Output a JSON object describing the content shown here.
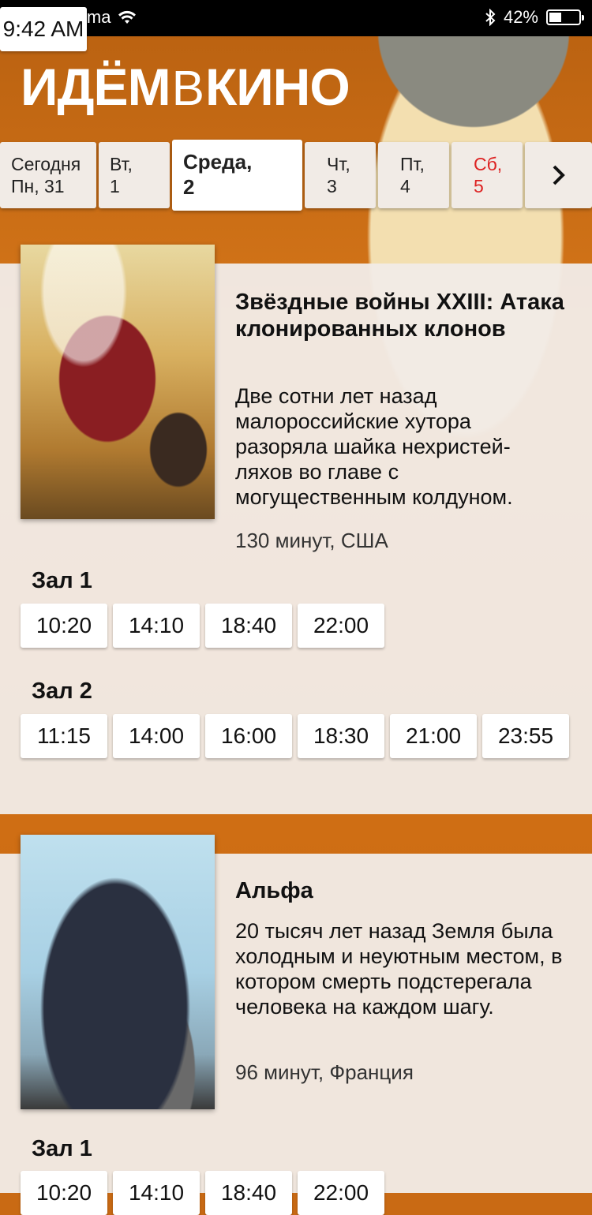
{
  "status_bar": {
    "signal": "●●●○○",
    "carrier": "Figma",
    "time": "9:42 AM",
    "battery": "42%",
    "battery_level": 0.42
  },
  "logo": {
    "part1": "ИДЁМ",
    "part2": "В",
    "part3": "КИНО"
  },
  "days": [
    {
      "line1": "Сегодня",
      "line2": "Пн, 31"
    },
    {
      "line1": "Вт,",
      "line2": "1"
    },
    {
      "line1": "Среда,",
      "line2": "2"
    },
    {
      "line1": "Чт,",
      "line2": "3"
    },
    {
      "line1": "Пт,",
      "line2": "4"
    },
    {
      "line1": "Сб,",
      "line2": "5"
    }
  ],
  "movies": [
    {
      "title": "Звёздные войны XXIII: Атака клонированных клонов",
      "description": "Две сотни лет назад малороссийские хутора разоряла шайка нехристей-ляхов во главе с могущественным колдуном.",
      "meta": "130 минут, США",
      "halls": [
        {
          "name": "Зал 1",
          "times": [
            "10:20",
            "14:10",
            "18:40",
            "22:00"
          ]
        },
        {
          "name": "Зал 2",
          "times": [
            "11:15",
            "14:00",
            "16:00",
            "18:30",
            "21:00",
            "23:55"
          ]
        }
      ]
    },
    {
      "title": "Альфа",
      "description": "20 тысяч лет назад Земля была холодным и неуютным местом, в котором смерть подстерегала человека на каждом шагу.",
      "meta": "96 минут, Франция",
      "halls": [
        {
          "name": "Зал 1",
          "times": [
            "10:20",
            "14:10",
            "18:40",
            "22:00"
          ]
        }
      ]
    }
  ]
}
